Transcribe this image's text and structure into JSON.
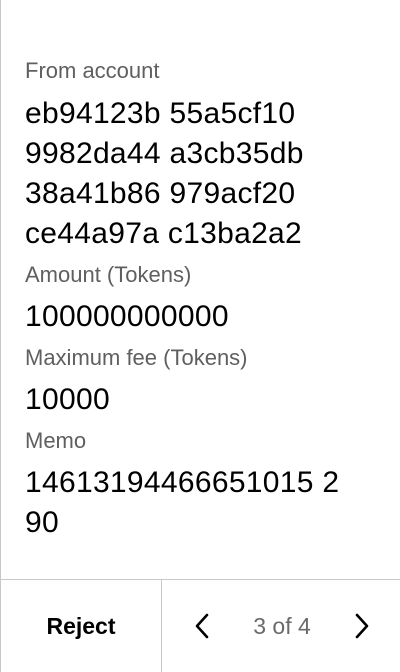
{
  "fields": {
    "from": {
      "label": "From account",
      "lines": [
        "eb94123b 55a5cf10",
        "9982da44 a3cb35db",
        "38a41b86 979acf20",
        "ce44a97a c13ba2a2"
      ]
    },
    "amount": {
      "label": "Amount (Tokens)",
      "value": "100000000000"
    },
    "fee": {
      "label": "Maximum fee (Tokens)",
      "value": "10000"
    },
    "memo": {
      "label": "Memo",
      "lines": [
        "14613194466651015 2",
        "90"
      ]
    }
  },
  "footer": {
    "reject_label": "Reject",
    "page_indicator": "3 of 4",
    "prev_icon": "chevron-left-icon",
    "next_icon": "chevron-right-icon"
  }
}
